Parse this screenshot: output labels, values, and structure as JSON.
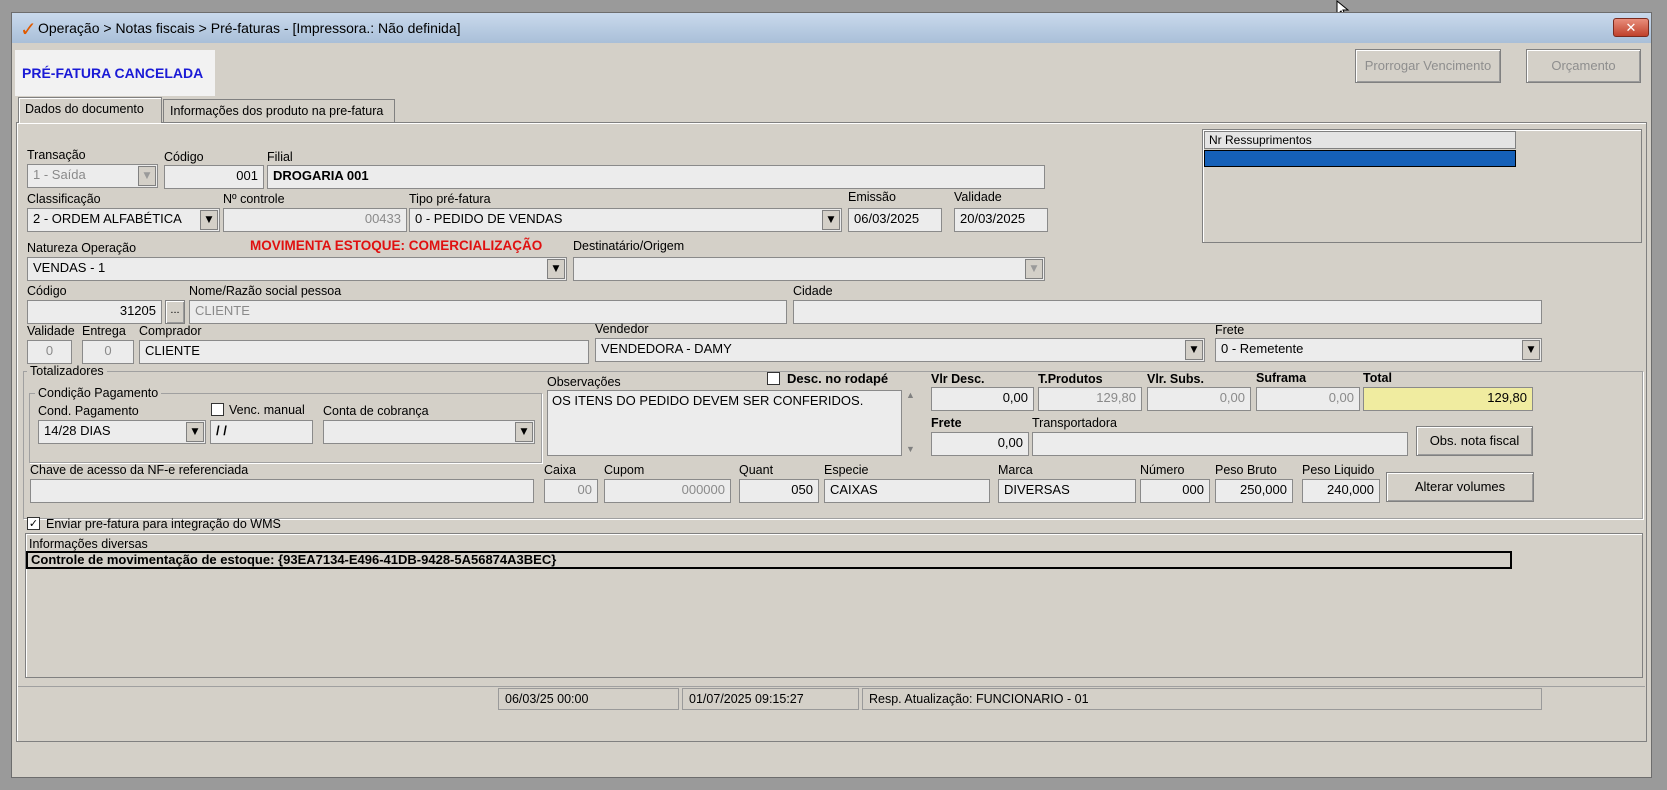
{
  "window": {
    "title": "Operação > Notas fiscais > Pré-faturas - [Impressora.: Não definida]",
    "close_glyph": "✕",
    "logo_glyph": "✓"
  },
  "status_banner": "PRÉ-FATURA CANCELADA",
  "toolbar": {
    "prorrogar_label": "Prorrogar Vencimento",
    "orcamento_label": "Orçamento"
  },
  "tabs": [
    {
      "label": "Dados do documento"
    },
    {
      "label": "Informações dos produto na pre-fatura"
    }
  ],
  "form": {
    "transacao": {
      "label": "Transação",
      "value": "1 - Saída"
    },
    "codigo": {
      "label": "Código",
      "value": "001"
    },
    "filial": {
      "label": "Filial",
      "value": "DROGARIA 001"
    },
    "classificacao": {
      "label": "Classificação",
      "value": "2 - ORDEM ALFABÉTICA"
    },
    "nr_controle": {
      "label": "Nº controle",
      "value": "00433"
    },
    "tipo_prefatura": {
      "label": "Tipo pré-fatura",
      "value": "0  - PEDIDO DE VENDAS"
    },
    "emissao": {
      "label": "Emissão",
      "value": "06/03/2025"
    },
    "validade": {
      "label": "Validade",
      "value": "20/03/2025"
    },
    "natureza": {
      "label": "Natureza  Operação",
      "value": "VENDAS - 1"
    },
    "movimenta_estoque": "MOVIMENTA ESTOQUE: COMERCIALIZAÇÃO",
    "destinatario": {
      "label": "Destinatário/Origem",
      "value": ""
    },
    "pessoa_codigo": {
      "label": "Código",
      "value": "31205"
    },
    "lookup_label": "...",
    "nome": {
      "label": "Nome/Razão social pessoa",
      "value": "CLIENTE"
    },
    "cidade": {
      "label": "Cidade",
      "value": ""
    },
    "validade_dias": {
      "label": "Validade",
      "value": "0"
    },
    "entrega": {
      "label": "Entrega",
      "value": "0"
    },
    "comprador": {
      "label": "Comprador",
      "value": "CLIENTE"
    },
    "vendedor": {
      "label": "Vendedor",
      "value": "VENDEDORA - DAMY"
    },
    "frete_tipo": {
      "label": "Frete",
      "value": "0 - Remetente"
    }
  },
  "ressuprimentos": {
    "header": "Nr Ressuprimentos"
  },
  "totalizadores": {
    "label": "Totalizadores",
    "condicao_label": "Condição Pagamento",
    "cond_pagamento": {
      "label": "Cond. Pagamento",
      "value": "14/28 DIAS"
    },
    "venc_manual": {
      "label": "Venc. manual",
      "value": " / /"
    },
    "conta_cobranca": {
      "label": "Conta de cobrança",
      "value": ""
    },
    "observacoes": {
      "label": "Observações",
      "value": "OS ITENS DO PEDIDO DEVEM SER CONFERIDOS."
    },
    "desc_rodape": {
      "label": "Desc. no rodapé",
      "checked": false
    },
    "vlr_desc": {
      "label": "Vlr Desc.",
      "value": "0,00"
    },
    "t_produtos": {
      "label": "T.Produtos",
      "value": "129,80"
    },
    "vlr_subs": {
      "label": "Vlr. Subs.",
      "value": "0,00"
    },
    "suframa": {
      "label": "Suframa",
      "value": "0,00"
    },
    "total": {
      "label": "Total",
      "value": "129,80"
    },
    "frete": {
      "label": "Frete",
      "value": "0,00"
    },
    "transportadora": {
      "label": "Transportadora",
      "value": ""
    },
    "obs_nota_label": "Obs. nota fiscal",
    "chave_nfe": {
      "label": "Chave de acesso da NF-e referenciada",
      "value": ""
    },
    "caixa": {
      "label": "Caixa",
      "value": "00"
    },
    "cupom": {
      "label": "Cupom",
      "value": "000000"
    },
    "quant": {
      "label": "Quant",
      "value": "050"
    },
    "especie": {
      "label": "Especie",
      "value": "CAIXAS"
    },
    "marca": {
      "label": "Marca",
      "value": "DIVERSAS"
    },
    "numero": {
      "label": "Número",
      "value": "000"
    },
    "peso_bruto": {
      "label": "Peso Bruto",
      "value": "250,000"
    },
    "peso_liquido": {
      "label": "Peso Liquido",
      "value": "240,000"
    },
    "alterar_volumes_label": "Alterar volumes"
  },
  "wms": {
    "label": "Enviar pre-fatura para integração do WMS",
    "checked": true
  },
  "info": {
    "header": "Informações diversas",
    "line": "Controle de movimentação de estoque: {93EA7134-E496-41DB-9428-5A56874A3BEC}"
  },
  "statusbar": {
    "date1": "06/03/25 00:00",
    "date2": "01/07/2025 09:15:27",
    "resp": "Resp. Atualização: FUNCIONARIO - 01"
  },
  "colors": {
    "banner": "#1a1ad6",
    "warning": "#e01010",
    "total_bg": "#f0eca0",
    "selection": "#1560b8"
  },
  "icons": [
    "check-logo-icon",
    "close-icon",
    "chevron-down-icon",
    "scroll-up-icon",
    "scroll-down-icon",
    "mouse-cursor-icon"
  ]
}
